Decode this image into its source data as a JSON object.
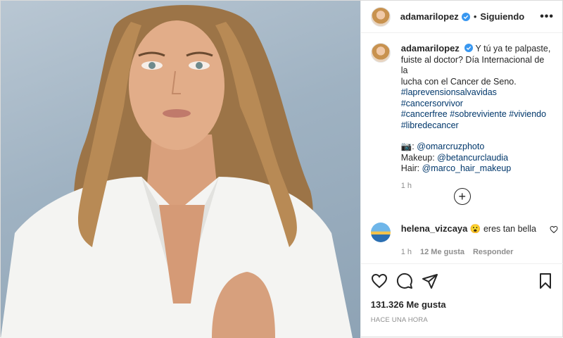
{
  "post": {
    "username": "adamarilopez",
    "follow_separator": "•",
    "follow_status": "Siguiendo",
    "more_label": "•••"
  },
  "caption": {
    "username": "adamarilopez",
    "text_line1": "Y tú ya te palpaste,",
    "text_line2": "fuiste al doctor? Día Internacional de la",
    "text_line3": "lucha con el Cancer de Seno.",
    "hashtags_line1": "#laprevensionsalvavidas #cancersorvivor",
    "hashtags_line2": "#cancerfree #sobreviviente #viviendo",
    "hashtags_line3": "#libredecancer",
    "camera_emoji": "📷",
    "photo_credit": "@omarcruzphoto",
    "makeup_label": "Makeup:",
    "makeup_credit": "@betancurclaudia",
    "hair_label": "Hair:",
    "hair_credit": "@marco_hair_makeup",
    "time": "1 h"
  },
  "load_more": {
    "icon": "plus-circle-icon",
    "label": "+"
  },
  "comment": {
    "username": "helena_vizcaya",
    "emoji": "😮",
    "text": "eres tan bella",
    "time": "1 h",
    "likes": "12 Me gusta",
    "reply": "Responder"
  },
  "actions": {
    "likes_count": "131.326 Me gusta",
    "date": "HACE UNA HORA"
  },
  "colors": {
    "verified": "#3897f0",
    "link": "#00376b",
    "muted": "#8e8e8e"
  }
}
